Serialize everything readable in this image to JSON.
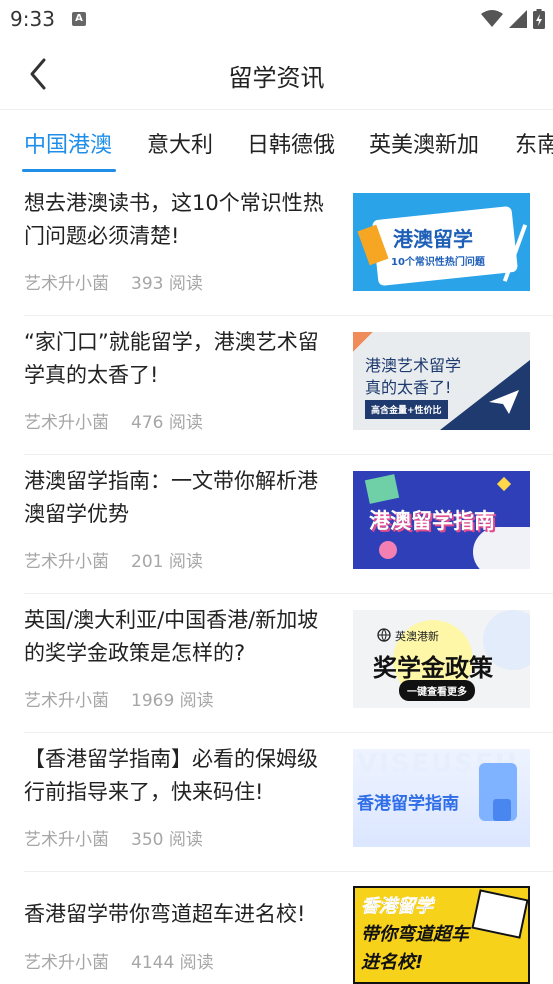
{
  "status": {
    "time": "9:33",
    "notif_glyph": "A"
  },
  "header": {
    "title": "留学资讯"
  },
  "tabs": [
    {
      "label": "中国港澳",
      "active": true
    },
    {
      "label": "意大利"
    },
    {
      "label": "日韩德俄"
    },
    {
      "label": "英美澳新加"
    },
    {
      "label": "东南"
    }
  ],
  "articles": [
    {
      "title": "想去港澳读书，这10个常识性热门问题必须清楚!",
      "author": "艺术升小菌",
      "reads": "393 阅读",
      "thumb": {
        "line1": "港澳留学",
        "line2": "10个常识性热门问题"
      }
    },
    {
      "title": "“家门口”就能留学，港澳艺术留学真的太香了!",
      "author": "艺术升小菌",
      "reads": "476 阅读",
      "thumb": {
        "line1": "港澳艺术留学",
        "line2": "真的太香了!",
        "tag": "高含金量+性价比"
      }
    },
    {
      "title": "港澳留学指南：一文带你解析港澳留学优势",
      "author": "艺术升小菌",
      "reads": "201 阅读",
      "thumb": {
        "line1": "港澳留学指南"
      }
    },
    {
      "title": "英国/澳大利亚/中国香港/新加坡的奖学金政策是怎样的?",
      "author": "艺术升小菌",
      "reads": "1969 阅读",
      "thumb": {
        "top": "英澳港新",
        "line1": "奖学金政策",
        "line2": "一键查看更多"
      }
    },
    {
      "title": "【香港留学指南】必看的保姆级行前指导来了，快来码住!",
      "author": "艺术升小菌",
      "reads": "350 阅读",
      "thumb": {
        "line1": "香港留学指南",
        "bg_word": "VISEUSEH"
      }
    },
    {
      "title": "香港留学带你弯道超车进名校!",
      "author": "艺术升小菌",
      "reads": "4144 阅读",
      "thumb": {
        "line1": "香港留学",
        "line2": "带你弯道超车",
        "line3": "进名校!"
      }
    }
  ]
}
